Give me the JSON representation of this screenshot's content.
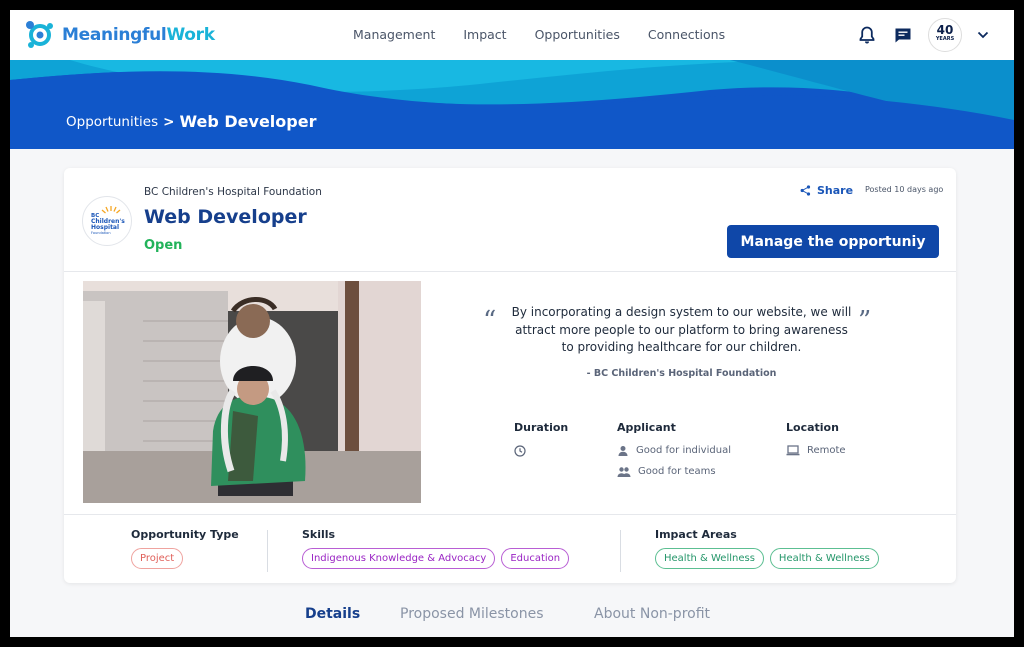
{
  "brand": {
    "name_part1": "Meaningful",
    "name_part2": "Work",
    "color_primary": "#2b7fd6",
    "color_secondary": "#1ab3d8"
  },
  "nav": {
    "links": [
      "Management",
      "Impact",
      "Opportunities",
      "Connections"
    ],
    "icons": [
      "bell-icon",
      "chat-icon"
    ],
    "avatar_text": "40",
    "avatar_subtext": "YEARS"
  },
  "breadcrumb": {
    "parent": "Opportunities",
    "separator": ">",
    "current": "Web Developer"
  },
  "opportunity": {
    "org_name": "BC Children's Hospital Foundation",
    "org_logo_text": [
      "BC",
      "Children's",
      "Hospital",
      "Foundation"
    ],
    "title": "Web Developer",
    "status": "Open",
    "share_label": "Share",
    "posted": "Posted 10 days ago",
    "manage_label": "Manage the opportuniy"
  },
  "quote": {
    "open_mark": "“",
    "close_mark": "”",
    "text": "By incorporating a design system to our website, we will attract more people to our platform to bring awareness to providing healthcare for our children.",
    "attribution": "- BC Children's Hospital Foundation"
  },
  "details": {
    "duration": {
      "label": "Duration",
      "icon": "clock-icon"
    },
    "applicant": {
      "label": "Applicant",
      "items": [
        {
          "icon": "person-icon",
          "text": "Good for individual"
        },
        {
          "icon": "group-icon",
          "text": "Good for teams"
        }
      ]
    },
    "location": {
      "label": "Location",
      "items": [
        {
          "icon": "laptop-icon",
          "text": "Remote"
        }
      ]
    }
  },
  "tags": {
    "opportunity_type": {
      "label": "Opportunity Type",
      "values": [
        "Project"
      ]
    },
    "skills": {
      "label": "Skills",
      "values": [
        "Indigenous Knowledge & Advocacy",
        "Education"
      ]
    },
    "impact_areas": {
      "label": "Impact Areas",
      "values": [
        "Health & Wellness",
        "Health & Wellness"
      ]
    }
  },
  "tabs": [
    {
      "label": "Details",
      "active": true
    },
    {
      "label": "Proposed Milestones",
      "active": false
    },
    {
      "label": "About Non-profit",
      "active": false
    }
  ],
  "colors": {
    "hero_blue": "#1057c8",
    "accent_cyan": "#1ab3d8",
    "button_blue": "#0f47a8",
    "open_green": "#22b35a"
  }
}
